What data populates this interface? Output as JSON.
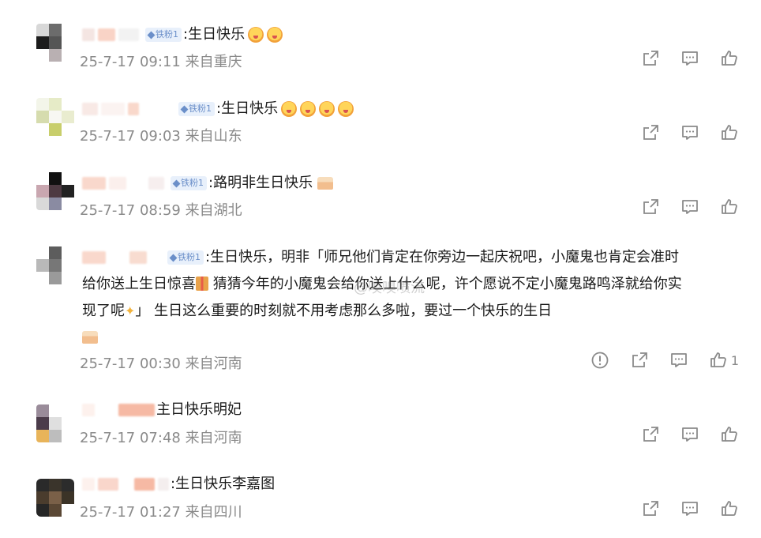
{
  "badge_label": "铁粉1",
  "watermark": "@嗅嗅喷流",
  "comments": [
    {
      "text": ":生日快乐",
      "time": "25-7-17 09:11",
      "location": "来自重庆",
      "emoji_count": 2
    },
    {
      "text": ":生日快乐",
      "time": "25-7-17 09:03",
      "location": "来自山东",
      "emoji_count": 4
    },
    {
      "text": ":路明非生日快乐",
      "time": "25-7-17 08:59",
      "location": "来自湖北"
    },
    {
      "text_part1": ":生日快乐，明非「师兄他们肯定在你旁边一起庆祝吧，小魔鬼也肯定会准时",
      "text_part2a": "给你送上生日惊喜",
      "text_part2b": "猜猜今年的小魔鬼会给你送上什么呢，许个愿说不定小魔鬼路鸣泽就给你实",
      "text_part3a": "现了呢",
      "text_part3b": "」 生日这么重要的时刻就不用考虑那么多啦，要过一个快乐的生日",
      "time": "25-7-17 00:30",
      "location": "来自河南",
      "like_count": "1"
    },
    {
      "text": "主日快乐明妃",
      "time": "25-7-17 07:48",
      "location": "来自河南"
    },
    {
      "text": ":生日快乐李嘉图",
      "time": "25-7-17 01:27",
      "location": "来自四川"
    }
  ]
}
